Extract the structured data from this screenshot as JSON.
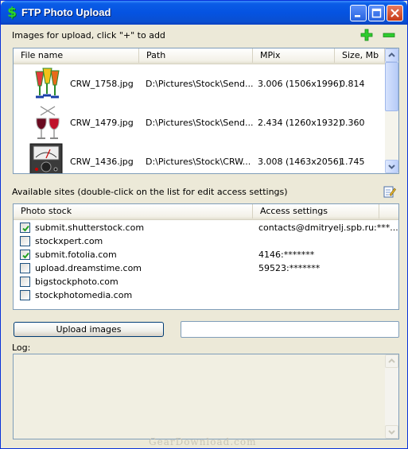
{
  "window": {
    "title": "FTP Photo Upload",
    "accent": "#0a5ce6"
  },
  "images_section": {
    "label": "Images for upload, click \"+\" to add",
    "add_icon": "plus-icon",
    "remove_icon": "minus-icon",
    "columns": [
      "File name",
      "Path",
      "MPix",
      "Size, Mb"
    ],
    "rows": [
      {
        "file": "CRW_1758.jpg",
        "path": "D:\\Pictures\\Stock\\Send...",
        "mpix": "3.006 (1506x1996)",
        "size": "0.814",
        "thumb": "champagne-glasses"
      },
      {
        "file": "CRW_1479.jpg",
        "path": "D:\\Pictures\\Stock\\Send...",
        "mpix": "2.434 (1260x1932)",
        "size": "0.360",
        "thumb": "wine-glasses-toast"
      },
      {
        "file": "CRW_1436.jpg",
        "path": "D:\\Pictures\\Stock\\CRW...",
        "mpix": "3.008 (1463x2056)",
        "size": "1.745",
        "thumb": "analog-multimeter"
      }
    ]
  },
  "sites_section": {
    "label": "Available sites (double-click on the list for edit access settings)",
    "edit_icon": "edit-settings-icon",
    "columns": [
      "Photo stock",
      "Access settings"
    ],
    "rows": [
      {
        "name": "submit.shutterstock.com",
        "checked": true,
        "access": "contacts@dmitryelj.spb.ru:***..."
      },
      {
        "name": "stockxpert.com",
        "checked": false,
        "access": ""
      },
      {
        "name": "submit.fotolia.com",
        "checked": true,
        "access": "4146:*******"
      },
      {
        "name": "upload.dreamstime.com",
        "checked": false,
        "access": "59523:*******"
      },
      {
        "name": "bigstockphoto.com",
        "checked": false,
        "access": ""
      },
      {
        "name": "stockphotomedia.com",
        "checked": false,
        "access": ""
      }
    ]
  },
  "upload": {
    "button_label": "Upload images",
    "status_value": ""
  },
  "log": {
    "label": "Log:",
    "content": ""
  },
  "watermark": "GearDownload.com"
}
